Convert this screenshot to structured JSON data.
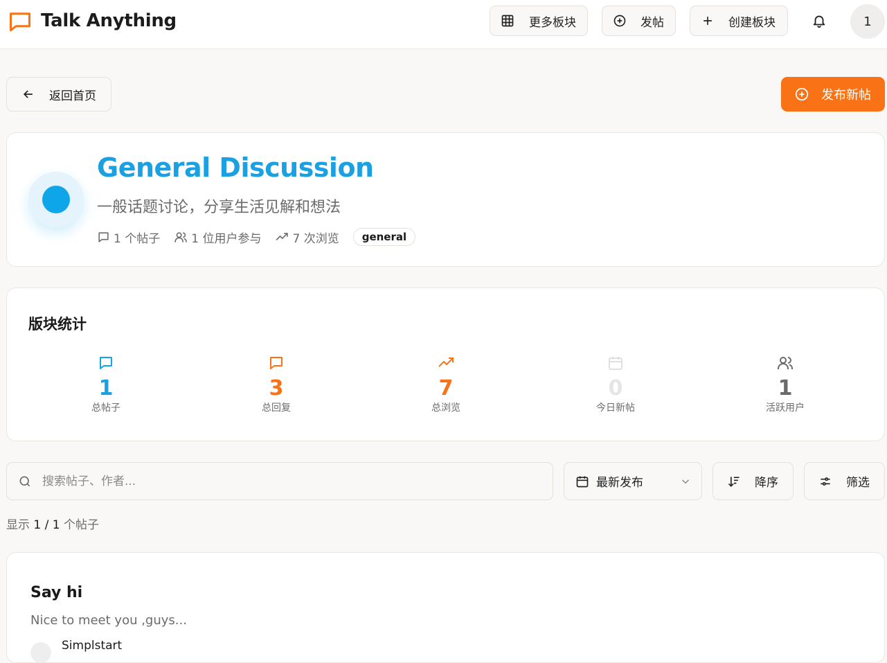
{
  "header": {
    "app_title": "Talk Anything",
    "more_boards_label": "更多板块",
    "post_label": "发帖",
    "create_board_label": "创建板块",
    "user_avatar_text": "1"
  },
  "actions": {
    "back_label": "返回首页",
    "new_post_label": "发布新帖"
  },
  "board": {
    "title": "General Discussion",
    "description": "一般话题讨论，分享生活见解和想法",
    "posts_meta": "1 个帖子",
    "users_meta": "1 位用户参与",
    "views_meta": "7 次浏览",
    "tag": "general"
  },
  "stats": {
    "title": "版块统计",
    "items": [
      {
        "value": "1",
        "label": "总帖子",
        "icon": "message-square-icon",
        "color": "#0ea5e9"
      },
      {
        "value": "3",
        "label": "总回复",
        "icon": "message-square-icon",
        "color": "#f97316"
      },
      {
        "value": "7",
        "label": "总浏览",
        "icon": "trending-up-icon",
        "color": "#f97316"
      },
      {
        "value": "0",
        "label": "今日新帖",
        "icon": "calendar-icon",
        "color": "#e5e5e5"
      },
      {
        "value": "1",
        "label": "活跃用户",
        "icon": "users-icon",
        "color": "#6b6b6b"
      }
    ]
  },
  "toolbar": {
    "search_placeholder": "搜索帖子、作者...",
    "sort_value": "最新发布",
    "order_label": "降序",
    "filter_label": "筛选"
  },
  "results": {
    "prefix": "显示",
    "shown": "1 / 1",
    "suffix": "个帖子"
  },
  "post": {
    "title": "Say hi",
    "excerpt": "Nice to meet you ,guys...",
    "author": "Simplstart"
  },
  "colors": {
    "brand": "#f97316",
    "board_accent": "#0ea5e9",
    "background": "#faf8f6"
  }
}
